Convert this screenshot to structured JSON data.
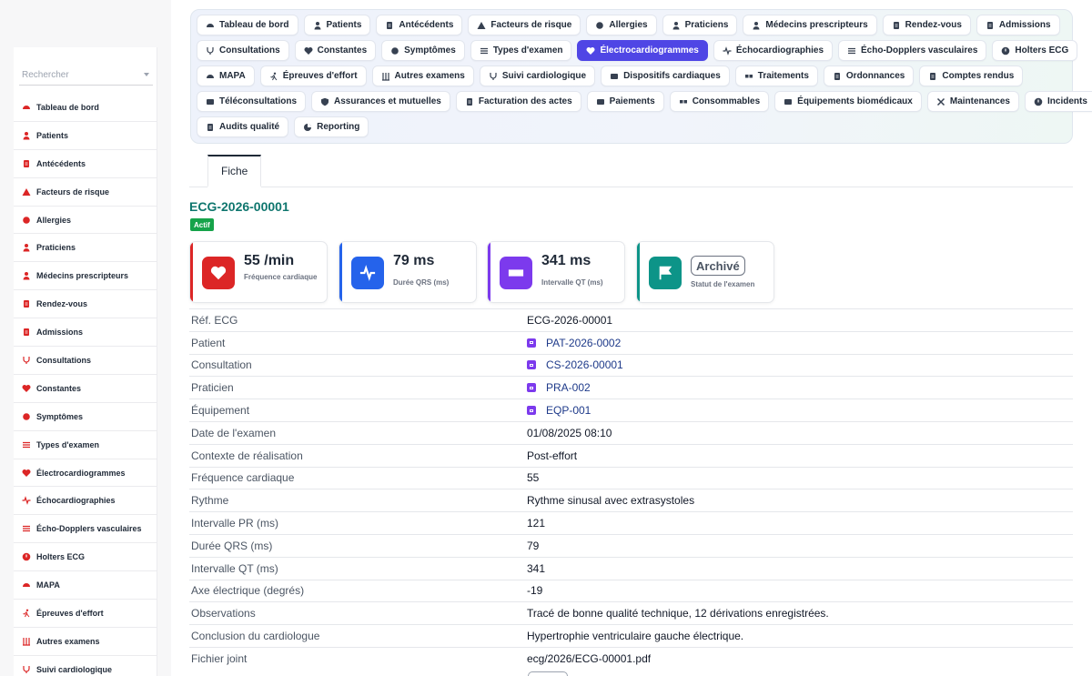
{
  "search": {
    "placeholder": "Rechercher"
  },
  "colors": {
    "accent": "#4f46e5",
    "title": "#0f766e",
    "status_active": "#16a34a",
    "sidebar_icon": "#dc2626"
  },
  "sidebar": {
    "items": [
      {
        "label": "Tableau de bord",
        "icon": "dashboard-icon"
      },
      {
        "label": "Patients",
        "icon": "user-icon"
      },
      {
        "label": "Antécédents",
        "icon": "clipboard-icon"
      },
      {
        "label": "Facteurs de risque",
        "icon": "warning-icon"
      },
      {
        "label": "Allergies",
        "icon": "hand-icon"
      },
      {
        "label": "Praticiens",
        "icon": "doctor-icon"
      },
      {
        "label": "Médecins prescripteurs",
        "icon": "user-doctor-icon"
      },
      {
        "label": "Rendez-vous",
        "icon": "calendar-icon"
      },
      {
        "label": "Admissions",
        "icon": "clipboard-check-icon"
      },
      {
        "label": "Consultations",
        "icon": "stethoscope-icon"
      },
      {
        "label": "Constantes",
        "icon": "heart-icon"
      },
      {
        "label": "Symptômes",
        "icon": "head-icon"
      },
      {
        "label": "Types d'examen",
        "icon": "list-icon"
      },
      {
        "label": "Électrocardiogrammes",
        "icon": "heart-pulse-icon"
      },
      {
        "label": "Échocardiographies",
        "icon": "wave-icon"
      },
      {
        "label": "Écho-Dopplers vasculaires",
        "icon": "lines-icon"
      },
      {
        "label": "Holters ECG",
        "icon": "clock-icon"
      },
      {
        "label": "MAPA",
        "icon": "gauge-icon"
      },
      {
        "label": "Épreuves d'effort",
        "icon": "running-icon"
      },
      {
        "label": "Autres examens",
        "icon": "vials-icon"
      },
      {
        "label": "Suivi cardiologique",
        "icon": "stethoscope-icon"
      }
    ]
  },
  "nav": {
    "rows": [
      [
        {
          "label": "Tableau de bord",
          "icon": "dashboard-icon"
        },
        {
          "label": "Patients",
          "icon": "user-icon"
        },
        {
          "label": "Antécédents",
          "icon": "clipboard-icon"
        },
        {
          "label": "Facteurs de risque",
          "icon": "warning-icon"
        },
        {
          "label": "Allergies",
          "icon": "hand-icon"
        },
        {
          "label": "Praticiens",
          "icon": "doctor-icon"
        },
        {
          "label": "Médecins prescripteurs",
          "icon": "user-doctor-icon"
        },
        {
          "label": "Rendez-vous",
          "icon": "calendar-icon"
        },
        {
          "label": "Admissions",
          "icon": "clipboard-check-icon"
        }
      ],
      [
        {
          "label": "Consultations",
          "icon": "stethoscope-icon"
        },
        {
          "label": "Constantes",
          "icon": "heart-icon"
        },
        {
          "label": "Symptômes",
          "icon": "head-icon"
        },
        {
          "label": "Types d'examen",
          "icon": "list-icon"
        },
        {
          "label": "Électrocardiogrammes",
          "icon": "heart-pulse-icon",
          "active": true
        },
        {
          "label": "Échocardiographies",
          "icon": "wave-icon"
        },
        {
          "label": "Écho-Dopplers vasculaires",
          "icon": "lines-icon"
        },
        {
          "label": "Holters ECG",
          "icon": "clock-icon"
        }
      ],
      [
        {
          "label": "MAPA",
          "icon": "gauge-icon"
        },
        {
          "label": "Épreuves d'effort",
          "icon": "running-icon"
        },
        {
          "label": "Autres examens",
          "icon": "vials-icon"
        },
        {
          "label": "Suivi cardiologique",
          "icon": "stethoscope-icon"
        },
        {
          "label": "Dispositifs cardiaques",
          "icon": "device-icon"
        },
        {
          "label": "Traitements",
          "icon": "pills-icon"
        },
        {
          "label": "Ordonnances",
          "icon": "file-icon"
        },
        {
          "label": "Comptes rendus",
          "icon": "file-icon"
        }
      ],
      [
        {
          "label": "Téléconsultations",
          "icon": "video-icon"
        },
        {
          "label": "Assurances et mutuelles",
          "icon": "shield-icon"
        },
        {
          "label": "Facturation des actes",
          "icon": "invoice-icon"
        },
        {
          "label": "Paiements",
          "icon": "card-icon"
        },
        {
          "label": "Consommables",
          "icon": "boxes-icon"
        },
        {
          "label": "Équipements biomédicaux",
          "icon": "monitor-icon"
        },
        {
          "label": "Maintenances",
          "icon": "tools-icon"
        },
        {
          "label": "Incidents",
          "icon": "alert-circle-icon"
        }
      ],
      [
        {
          "label": "Audits qualité",
          "icon": "clipboard-icon"
        },
        {
          "label": "Reporting",
          "icon": "pie-icon"
        }
      ]
    ]
  },
  "tabs": {
    "fiche": "Fiche"
  },
  "record": {
    "title": "ECG-2026-00001",
    "status": "Actif"
  },
  "cards": [
    {
      "value": "55 /min",
      "label": "Fréquence cardiaque",
      "color": "#dc2626",
      "icon": "heart-pulse-icon"
    },
    {
      "value": "79 ms",
      "label": "Durée QRS (ms)",
      "color": "#2563eb",
      "icon": "wave-icon"
    },
    {
      "value": "341 ms",
      "label": "Intervalle QT (ms)",
      "color": "#7c3aed",
      "icon": "ruler-icon"
    },
    {
      "badge": "Archivé",
      "label": "Statut de l'examen",
      "color": "#0d9488",
      "icon": "flag-icon"
    }
  ],
  "details": [
    {
      "key": "Réf. ECG",
      "value": "ECG-2026-00001"
    },
    {
      "key": "Patient",
      "value": "PAT-2026-0002",
      "link": true
    },
    {
      "key": "Consultation",
      "value": "CS-2026-00001",
      "link": true
    },
    {
      "key": "Praticien",
      "value": "PRA-002",
      "link": true
    },
    {
      "key": "Équipement",
      "value": "EQP-001",
      "link": true
    },
    {
      "key": "Date de l'examen",
      "value": "01/08/2025 08:10"
    },
    {
      "key": "Contexte de réalisation",
      "value": "Post-effort"
    },
    {
      "key": "Fréquence cardiaque",
      "value": "55"
    },
    {
      "key": "Rythme",
      "value": "Rythme sinusal avec extrasystoles"
    },
    {
      "key": "Intervalle PR (ms)",
      "value": "121"
    },
    {
      "key": "Durée QRS (ms)",
      "value": "79"
    },
    {
      "key": "Intervalle QT (ms)",
      "value": "341"
    },
    {
      "key": "Axe électrique (degrés)",
      "value": "-19"
    },
    {
      "key": "Observations",
      "value": "Tracé de bonne qualité technique, 12 dérivations enregistrées."
    },
    {
      "key": "Conclusion du cardiologue",
      "value": "Hypertrophie ventriculaire gauche électrique."
    },
    {
      "key": "Fichier joint",
      "value": "ecg/2026/ECG-00001.pdf"
    }
  ]
}
